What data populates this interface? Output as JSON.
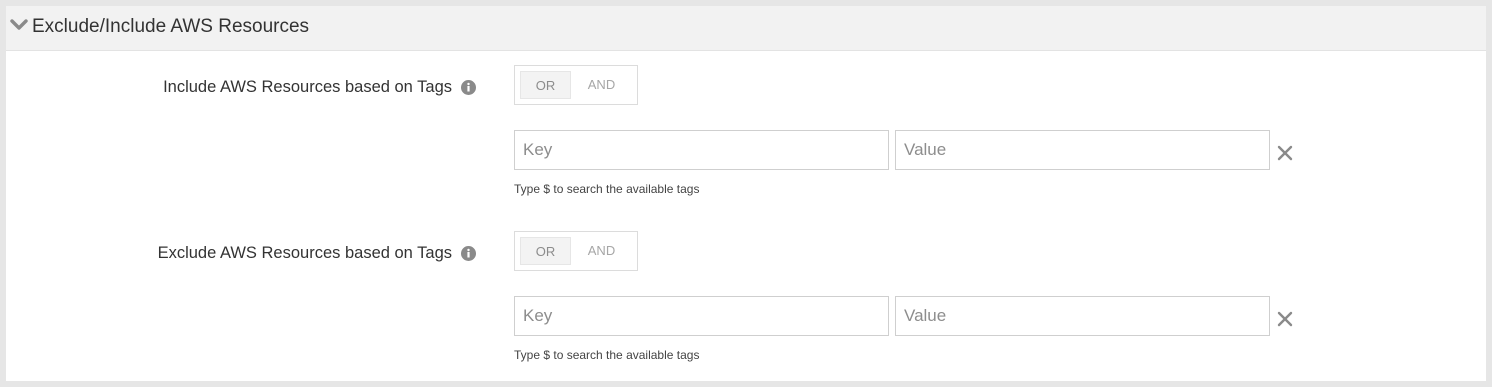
{
  "section": {
    "title": "Exclude/Include AWS Resources",
    "toggle_icon": "chevron-down-icon"
  },
  "include": {
    "label": "Include AWS Resources based on Tags",
    "info_icon": "info-icon",
    "operators": [
      "OR",
      "AND"
    ],
    "selected_operator": "OR",
    "key_placeholder": "Key",
    "value_placeholder": "Value",
    "key_value": "",
    "value_value": "",
    "hint": "Type $ to search the available tags",
    "remove_icon": "close-icon"
  },
  "exclude": {
    "label": "Exclude AWS Resources based on Tags",
    "info_icon": "info-icon",
    "operators": [
      "OR",
      "AND"
    ],
    "selected_operator": "OR",
    "key_placeholder": "Key",
    "value_placeholder": "Value",
    "key_value": "",
    "value_value": "",
    "hint": "Type $ to search the available tags",
    "remove_icon": "close-icon"
  },
  "colors": {
    "page_background": "#e6e6e6",
    "header_background": "#f2f2f2",
    "icon_gray": "#8a8a8a"
  }
}
